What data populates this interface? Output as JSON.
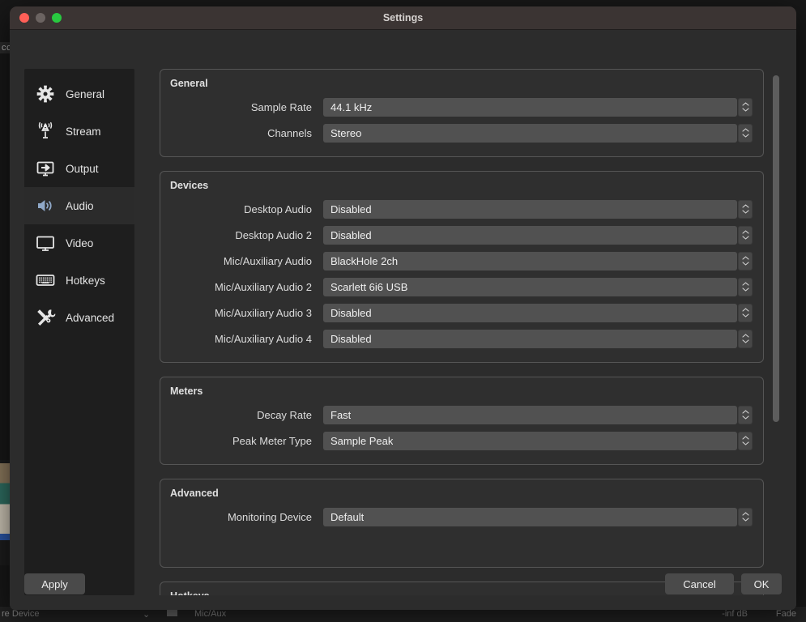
{
  "background": {
    "text_sliver": "cc",
    "mixer": {
      "device_label": "re Device",
      "chevron": "⌄",
      "source_label": "Mic/Aux",
      "db_value": "-inf dB",
      "fade_label": "Fade"
    }
  },
  "window": {
    "title": "Settings",
    "traffic_lights": {
      "close": "close-light",
      "minimize": "minimize-light",
      "maximize": "maximize-light"
    }
  },
  "sidebar": {
    "items": [
      {
        "label": "General",
        "icon": "gear-icon",
        "selected": false
      },
      {
        "label": "Stream",
        "icon": "broadcast-icon",
        "selected": false
      },
      {
        "label": "Output",
        "icon": "output-icon",
        "selected": false
      },
      {
        "label": "Audio",
        "icon": "speaker-icon",
        "selected": true
      },
      {
        "label": "Video",
        "icon": "monitor-icon",
        "selected": false
      },
      {
        "label": "Hotkeys",
        "icon": "keyboard-icon",
        "selected": false
      },
      {
        "label": "Advanced",
        "icon": "tools-icon",
        "selected": false
      }
    ]
  },
  "panel": {
    "groups": [
      {
        "title": "General",
        "fields": [
          {
            "label": "Sample Rate",
            "value": "44.1 kHz"
          },
          {
            "label": "Channels",
            "value": "Stereo"
          }
        ]
      },
      {
        "title": "Devices",
        "fields": [
          {
            "label": "Desktop Audio",
            "value": "Disabled"
          },
          {
            "label": "Desktop Audio 2",
            "value": "Disabled"
          },
          {
            "label": "Mic/Auxiliary Audio",
            "value": "BlackHole 2ch"
          },
          {
            "label": "Mic/Auxiliary Audio 2",
            "value": "Scarlett 6i6 USB"
          },
          {
            "label": "Mic/Auxiliary Audio 3",
            "value": "Disabled"
          },
          {
            "label": "Mic/Auxiliary Audio 4",
            "value": "Disabled"
          }
        ]
      },
      {
        "title": "Meters",
        "fields": [
          {
            "label": "Decay Rate",
            "value": "Fast"
          },
          {
            "label": "Peak Meter Type",
            "value": "Sample Peak"
          }
        ]
      },
      {
        "title": "Advanced",
        "fields": [
          {
            "label": "Monitoring Device",
            "value": "Default"
          }
        ]
      },
      {
        "title": "Hotkeys",
        "fields": [],
        "clipped": true
      }
    ]
  },
  "footer": {
    "apply_label": "Apply",
    "cancel_label": "Cancel",
    "ok_label": "OK"
  },
  "colors": {
    "window_bg": "#2c2c2c",
    "titlebar_bg": "#3b3433",
    "sidebar_bg": "#1e1e1e",
    "group_bg": "#2f2f2f",
    "combo_bg": "#515151",
    "accent_selected_icon": "#8fa8c8",
    "light_close": "#ff5f57",
    "light_minimize": "#6b6361",
    "light_maximize": "#28c840"
  }
}
